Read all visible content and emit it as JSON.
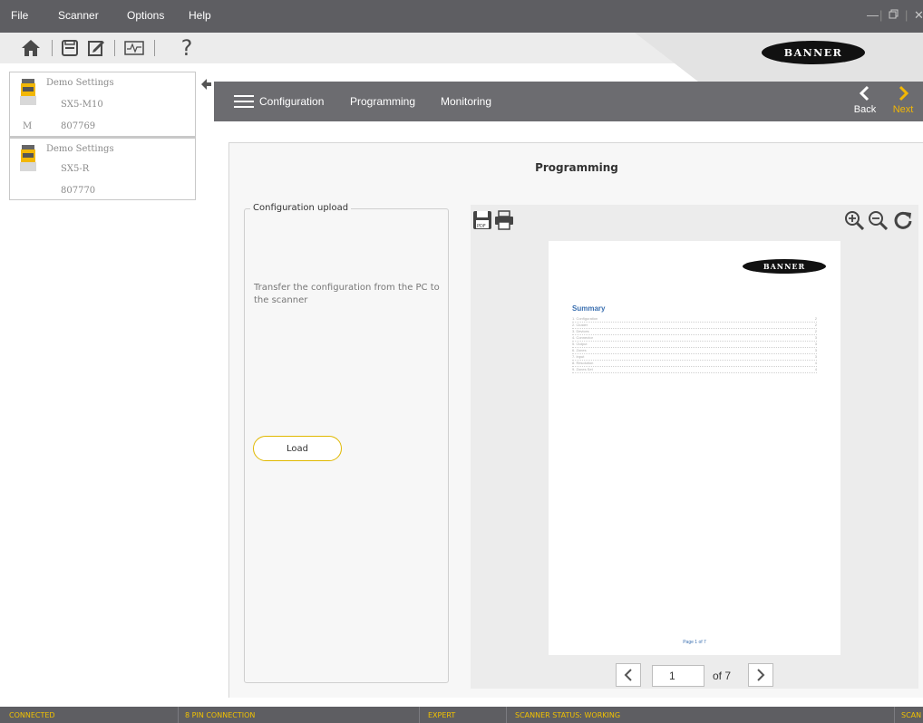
{
  "menubar": {
    "items": [
      "File",
      "Scanner",
      "Options",
      "Help"
    ]
  },
  "toolbar": {
    "icons": [
      "home-icon",
      "save-icon",
      "edit-icon",
      "monitor-icon",
      "help-icon"
    ],
    "help_glyph": "?"
  },
  "brand": {
    "logo_text": "BANNER",
    "accent_color": "#f2b705",
    "header_color": "#5e5e62"
  },
  "devices": [
    {
      "name": "Demo Settings",
      "model": "SX5-M10",
      "tag": "M",
      "serial": "807769"
    },
    {
      "name": "Demo Settings",
      "model": "SX5-R",
      "tag": "",
      "serial": "807770"
    }
  ],
  "nav": {
    "tabs": [
      "Configuration",
      "Programming",
      "Monitoring"
    ],
    "back_label": "Back",
    "next_label": "Next"
  },
  "page": {
    "title": "Programming",
    "config_section_title": "Configuration upload",
    "config_description": "Transfer the configuration from the PC to the scanner",
    "load_button": "Load"
  },
  "viewer": {
    "doc_logo": "BANNER",
    "doc_heading": "Summary",
    "toc": [
      {
        "label": "1. Configuration",
        "page": "2"
      },
      {
        "label": "2. Cluster",
        "page": "2"
      },
      {
        "label": "3. Devices",
        "page": "2"
      },
      {
        "label": "4. Connector",
        "page": "3"
      },
      {
        "label": "5. Output",
        "page": "3"
      },
      {
        "label": "6. Zones",
        "page": "3"
      },
      {
        "label": "7. Input",
        "page": "3"
      },
      {
        "label": "8. Resolution",
        "page": "4"
      },
      {
        "label": "9. Zones Set",
        "page": "4"
      }
    ],
    "page_footer": "Page 1 of 7",
    "current_page": "1",
    "of_pages": "of 7"
  },
  "status": {
    "connection": "CONNECTED",
    "pin": "8 PIN CONNECTION",
    "mode": "EXPERT",
    "scanner_status": "SCANNER STATUS: WORKING",
    "trailing": "SCAN"
  }
}
